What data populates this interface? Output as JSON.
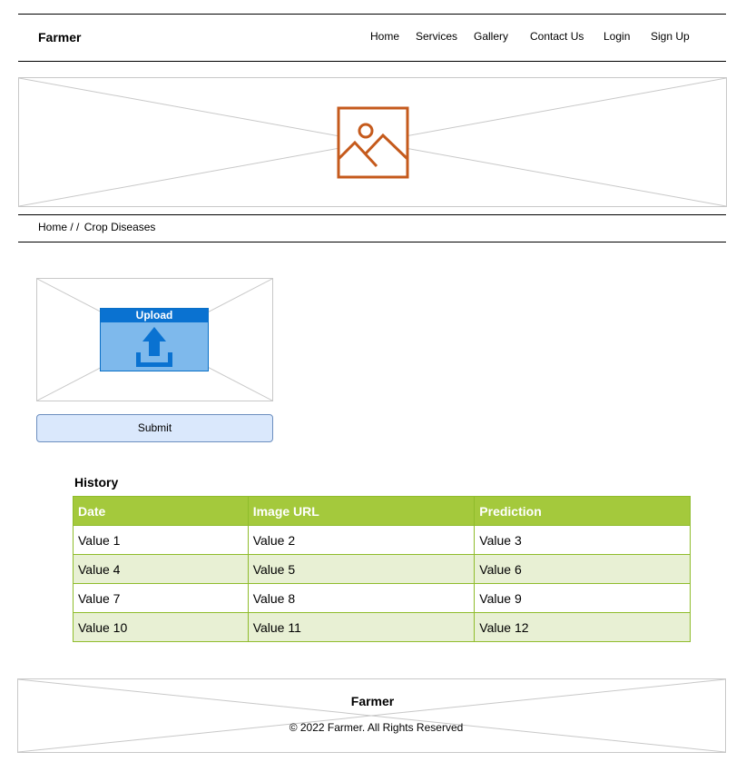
{
  "header": {
    "brand": "Farmer",
    "nav": [
      "Home",
      "Services",
      "Gallery",
      "Contact Us",
      "Login",
      "Sign Up"
    ]
  },
  "hero": {
    "icon": "image-icon",
    "icon_color": "#c55a1c"
  },
  "breadcrumb": {
    "home": "Home",
    "separator": "/ /",
    "current": "Crop Diseases"
  },
  "upload": {
    "title": "Upload",
    "icon": "upload-icon",
    "accent": "#0a72d1"
  },
  "form": {
    "submit_label": "Submit"
  },
  "history": {
    "title": "History",
    "columns": [
      "Date",
      "Image URL",
      "Prediction"
    ],
    "rows": [
      [
        "Value 1",
        "Value 2",
        "Value 3"
      ],
      [
        "Value 4",
        "Value 5",
        "Value 6"
      ],
      [
        "Value 7",
        "Value 8",
        "Value 9"
      ],
      [
        "Value 10",
        "Value 11",
        "Value 12"
      ]
    ],
    "header_color": "#a4c93c"
  },
  "footer": {
    "title": "Farmer",
    "copyright": "© 2022 Farmer. All Rights Reserved"
  }
}
